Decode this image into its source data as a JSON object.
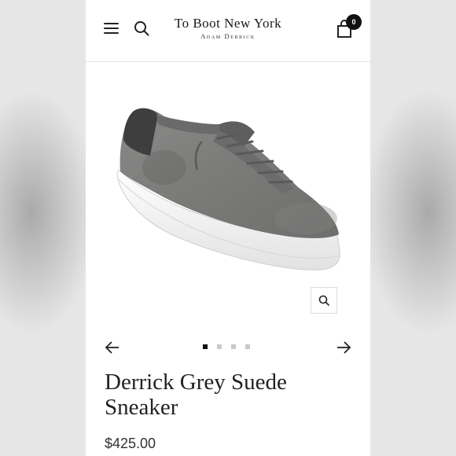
{
  "header": {
    "logo_title": "To Boot New York",
    "logo_subtitle": "Adam Derrick",
    "cart_count": "0",
    "menu_icon": "hamburger-menu-icon",
    "search_icon": "search-icon",
    "cart_icon": "shopping-bag-icon"
  },
  "gallery": {
    "image_subject": "grey suede low-top sneaker with white sole",
    "zoom_icon": "zoom-icon",
    "prev_icon": "arrow-left-icon",
    "next_icon": "arrow-right-icon",
    "slide_count": 4,
    "active_slide": 1
  },
  "product": {
    "title": "Derrick Grey Suede Sneaker",
    "price": "$425.00"
  },
  "colors": {
    "text": "#222222",
    "badge": "#111111",
    "dot_inactive": "#c8c8c8"
  }
}
